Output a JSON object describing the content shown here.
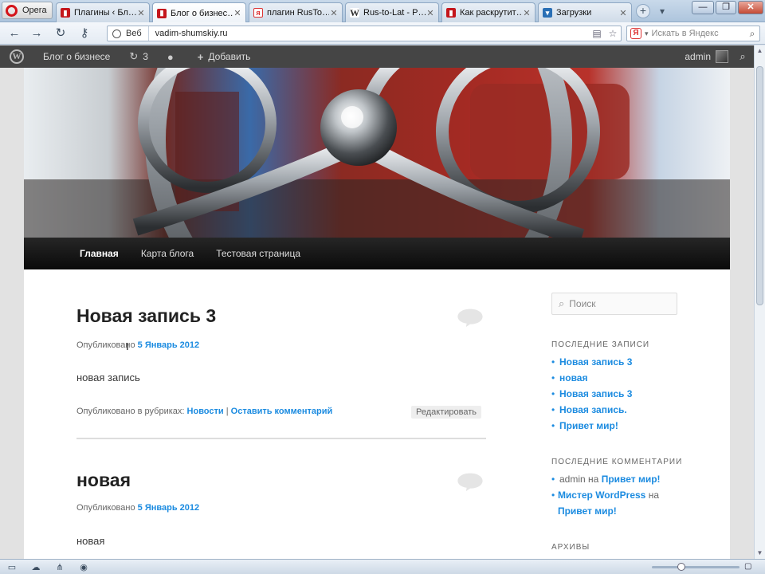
{
  "browser": {
    "menu_label": "Opera",
    "tabs": [
      {
        "label": "Плагины ‹ Бл…",
        "favicon": "red-book-icon",
        "active": false
      },
      {
        "label": "Блог о бизнес…",
        "favicon": "red-book-icon",
        "active": true
      },
      {
        "label": "плагин RusTo…",
        "favicon": "yandex-icon",
        "active": false
      },
      {
        "label": "Rus-to-Lat - P…",
        "favicon": "wikipedia-icon",
        "active": false
      },
      {
        "label": "Как раскрутит…",
        "favicon": "red-book-icon",
        "active": false
      },
      {
        "label": "Загрузки",
        "favicon": "downloads-icon",
        "active": false
      }
    ],
    "address": {
      "mode_label": "Веб",
      "url": "vadim-shumskiy.ru"
    },
    "search": {
      "placeholder": "Искать в Яндекс"
    }
  },
  "adminbar": {
    "site_name": "Блог о бизнесе",
    "updates_count": "3",
    "add_new_label": "Добавить",
    "user": "admin"
  },
  "site": {
    "menu": [
      {
        "label": "Главная",
        "current": true
      },
      {
        "label": "Карта блога",
        "current": false
      },
      {
        "label": "Тестовая страница",
        "current": false
      }
    ],
    "posts": [
      {
        "title": "Новая запись 3",
        "posted_prefix": "Опубликовано",
        "date": "5 Январь 2012",
        "content": "новая запись",
        "categories_prefix": "Опубликовано в рубриках:",
        "category": "Новости",
        "separator": "|",
        "comment_link": "Оставить комментарий",
        "edit_label": "Редактировать"
      },
      {
        "title": "новая",
        "posted_prefix": "Опубликовано",
        "date": "5 Январь 2012",
        "content": "новая"
      }
    ],
    "sidebar": {
      "search_placeholder": "Поиск",
      "recent_posts_title": "ПОСЛЕДНИЕ ЗАПИСИ",
      "recent_posts": [
        "Новая запись 3",
        "новая",
        "Новая запись 3",
        "Новая запись.",
        "Привет мир!"
      ],
      "recent_comments_title": "ПОСЛЕДНИЕ КОММЕНТАРИИ",
      "recent_comments": [
        {
          "author": "admin",
          "on": "на",
          "post": "Привет мир!"
        },
        {
          "author": "Мистер WordPress",
          "on": "на",
          "post": "Привет мир!"
        }
      ],
      "archives_title": "АРХИВЫ"
    }
  },
  "colors": {
    "link": "#1b8be0",
    "adminbar": "#454545",
    "nav": "#111111"
  }
}
